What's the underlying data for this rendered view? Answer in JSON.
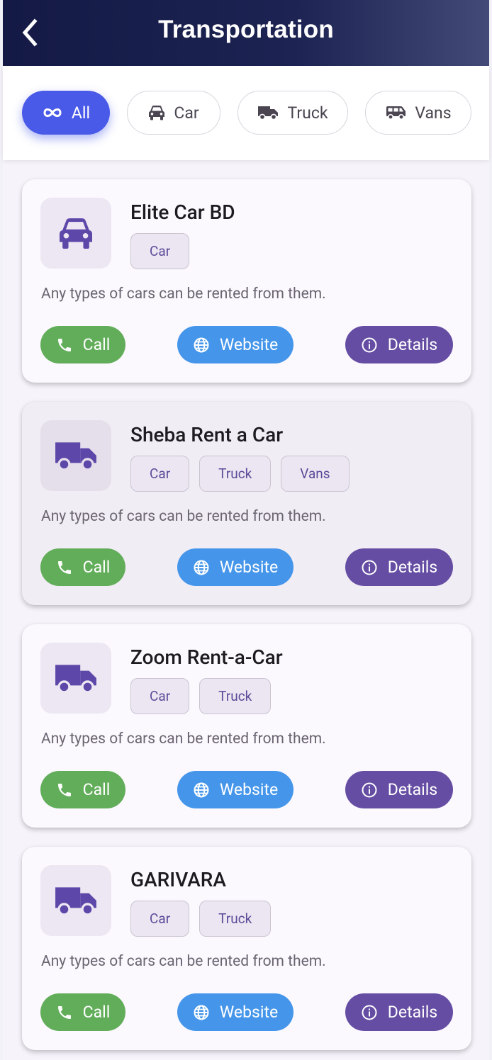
{
  "header": {
    "title": "Transportation"
  },
  "filters": [
    {
      "label": "All",
      "icon": "infinity-icon",
      "active": true
    },
    {
      "label": "Car",
      "icon": "car-icon",
      "active": false
    },
    {
      "label": "Truck",
      "icon": "truck-icon",
      "active": false
    },
    {
      "label": "Vans",
      "icon": "van-icon",
      "active": false
    }
  ],
  "actions": {
    "call": "Call",
    "website": "Website",
    "details": "Details"
  },
  "providers": [
    {
      "name": "Elite Car BD",
      "icon": "car-icon",
      "tags": [
        "Car"
      ],
      "description": "Any types of cars can be rented from them."
    },
    {
      "name": "Sheba Rent a Car",
      "icon": "truck-icon",
      "tags": [
        "Car",
        "Truck",
        "Vans"
      ],
      "description": "Any types of cars can be rented from them."
    },
    {
      "name": "Zoom Rent-a-Car",
      "icon": "truck-icon",
      "tags": [
        "Car",
        "Truck"
      ],
      "description": "Any types of cars can be rented from them."
    },
    {
      "name": "GARIVARA",
      "icon": "truck-icon",
      "tags": [
        "Car",
        "Truck"
      ],
      "description": "Any types of cars can be rented from them."
    }
  ],
  "colors": {
    "appbar_start": "#141a45",
    "appbar_end": "#434a77",
    "active_chip": "#4a5ae8",
    "call": "#62ad5a",
    "website": "#4596ea",
    "details": "#654da3",
    "icon": "#5d47a8"
  }
}
